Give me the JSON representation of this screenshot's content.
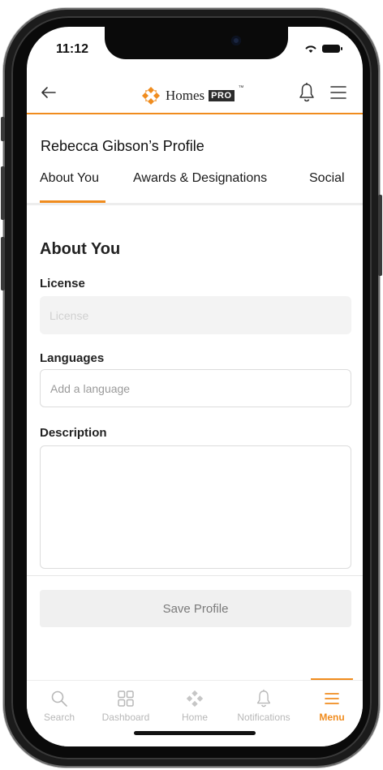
{
  "status_bar": {
    "time": "11:12"
  },
  "header": {
    "logo_text": "Homes",
    "logo_badge": "PRO",
    "logo_tm": "™"
  },
  "profile": {
    "title": "Rebecca Gibson’s Profile",
    "tabs": [
      {
        "label": "About You",
        "active": true
      },
      {
        "label": "Awards & Designations",
        "active": false
      },
      {
        "label": "Social",
        "active": false
      }
    ]
  },
  "form": {
    "section_heading": "About You",
    "license": {
      "label": "License",
      "placeholder": "License",
      "value": ""
    },
    "languages": {
      "label": "Languages",
      "placeholder": "Add a language",
      "value": ""
    },
    "description": {
      "label": "Description",
      "placeholder": "",
      "value": ""
    },
    "save_label": "Save Profile"
  },
  "bottom_nav": [
    {
      "label": "Search",
      "icon": "search-icon",
      "active": false
    },
    {
      "label": "Dashboard",
      "icon": "dashboard-icon",
      "active": false
    },
    {
      "label": "Home",
      "icon": "homes-logo-icon",
      "active": false
    },
    {
      "label": "Notifications",
      "icon": "bell-icon",
      "active": false
    },
    {
      "label": "Menu",
      "icon": "hamburger-icon",
      "active": true
    }
  ],
  "colors": {
    "accent": "#f08c1e",
    "text": "#222222",
    "muted": "#b8b8b8"
  }
}
